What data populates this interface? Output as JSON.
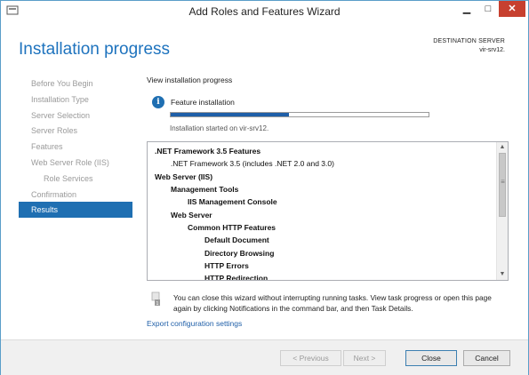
{
  "window": {
    "title": "Add Roles and Features Wizard",
    "controls": {
      "minimize": "▁",
      "maximize": "□",
      "close": "✕"
    }
  },
  "header": {
    "page_title": "Installation progress",
    "destination_label": "DESTINATION SERVER",
    "destination_value": "vir-srv12."
  },
  "sidebar": {
    "items": [
      {
        "label": "Before You Begin",
        "state": "disabled"
      },
      {
        "label": "Installation Type",
        "state": "disabled"
      },
      {
        "label": "Server Selection",
        "state": "disabled"
      },
      {
        "label": "Server Roles",
        "state": "disabled"
      },
      {
        "label": "Features",
        "state": "disabled"
      },
      {
        "label": "Web Server Role (IIS)",
        "state": "disabled"
      },
      {
        "label": "Role Services",
        "state": "disabled",
        "sub": true
      },
      {
        "label": "Confirmation",
        "state": "disabled"
      },
      {
        "label": "Results",
        "state": "active"
      }
    ]
  },
  "main": {
    "view_label": "View installation progress",
    "feature_label": "Feature installation",
    "progress_percent": 46,
    "started_text": "Installation started on vir-srv12.",
    "results": [
      {
        "text": ".NET Framework 3.5 Features",
        "level": 0
      },
      {
        "text": ".NET Framework 3.5 (includes .NET 2.0 and 3.0)",
        "level": 1
      },
      {
        "text": "Web Server (IIS)",
        "level": 0
      },
      {
        "text": "Management Tools",
        "level": 1
      },
      {
        "text": "IIS Management Console",
        "level": 2
      },
      {
        "text": "Web Server",
        "level": 1
      },
      {
        "text": "Common HTTP Features",
        "level": 2
      },
      {
        "text": "Default Document",
        "level": 3
      },
      {
        "text": "Directory Browsing",
        "level": 3
      },
      {
        "text": "HTTP Errors",
        "level": 3
      },
      {
        "text": "HTTP Redirection",
        "level": 3
      }
    ],
    "note": "You can close this wizard without interrupting running tasks. View task progress or open this page again by clicking Notifications in the command bar, and then Task Details.",
    "export_link": "Export configuration settings"
  },
  "footer": {
    "previous": "< Previous",
    "next": "Next >",
    "close": "Close",
    "cancel": "Cancel"
  },
  "icons": {
    "info": "i",
    "scroll_up": "▲",
    "scroll_down": "▼",
    "scroll_grip": "≡"
  },
  "colors": {
    "accent": "#1f6fb2",
    "title_blue": "#1e73be",
    "progress_fill": "#1f5fa8",
    "close_red": "#c7402f"
  }
}
